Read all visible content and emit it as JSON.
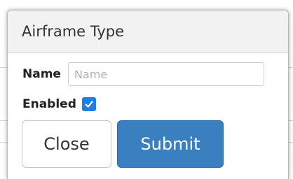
{
  "modal": {
    "title": "Airframe Type"
  },
  "form": {
    "name_label": "Name",
    "name_value": "",
    "name_placeholder": "Name",
    "enabled_label": "Enabled",
    "enabled_checked": true
  },
  "buttons": {
    "close_label": "Close",
    "submit_label": "Submit"
  },
  "colors": {
    "checkbox_accent": "#1e7fe0",
    "submit_bg": "#3a7fbf"
  },
  "icons": {
    "checkbox": "checkmark-icon"
  }
}
